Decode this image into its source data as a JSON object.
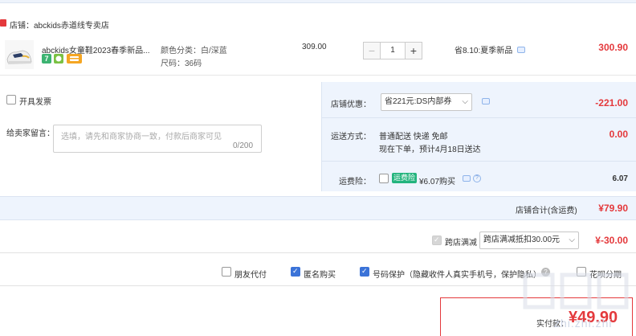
{
  "shop": {
    "label": "店铺：abckids赤道线专卖店"
  },
  "item": {
    "title": "abckids女童鞋2023春季新品...",
    "spec_color": "颜色分类：白/深蓝",
    "spec_size": "尺码：36码",
    "unit_price": "309.00",
    "quantity": "1",
    "minus_symbol": "−",
    "plus_symbol": "+",
    "promo": "省8.10:夏季新品",
    "total": "300.90",
    "badges": [
      {
        "text": "7",
        "color": "#3cb371"
      },
      {
        "text": "",
        "color": "#7ac143"
      },
      {
        "text": "",
        "color": "#f5a623"
      }
    ]
  },
  "left": {
    "invoice_label": "开具发票",
    "memo_label": "给卖家留言：",
    "memo_placeholder": "选填，请先和商家协商一致，付款后商家可见",
    "memo_count": "0/200"
  },
  "right": {
    "shop_discount_label": "店铺优惠：",
    "shop_discount_value": "省221元:DS内部券",
    "shop_discount_amount": "-221.00",
    "shipping_label": "运送方式：",
    "shipping_method": "普通配送 快递 免邮",
    "shipping_note": "现在下单，预计4月18日送达",
    "shipping_amount": "0.00",
    "insurance_label": "运费险：",
    "insurance_badge": "运费险",
    "insurance_price": "¥6.07购买",
    "insurance_amount": "6.07"
  },
  "subtotal": {
    "label": "店铺合计(含运费)",
    "amount": "¥79.90"
  },
  "cross_store": {
    "label": "跨店满减",
    "select_value": "跨店满减抵扣30.00元",
    "amount": "¥-30.00"
  },
  "options": {
    "friend_pay": "朋友代付",
    "anonymous": "匿名购买",
    "number_protect": "号码保护（隐藏收件人真实手机号，保护隐私）",
    "installment": "花呗分期"
  },
  "final": {
    "label": "实付款：",
    "amount": "¥49.90"
  },
  "watermark": {
    "text": "zhi.zhi.zhi"
  },
  "colors": {
    "accent_red": "#e4393c",
    "band_blue": "#eef4fd",
    "check_blue": "#3b73d8"
  }
}
